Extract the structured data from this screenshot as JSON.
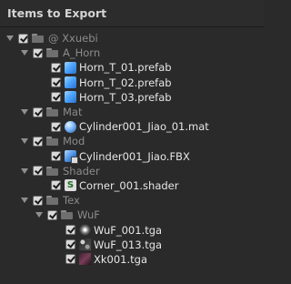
{
  "header": {
    "title": "Items to Export"
  },
  "tree": [
    {
      "level": 0,
      "expanded": true,
      "type": "folder",
      "name": "@ Xxuebi"
    },
    {
      "level": 1,
      "expanded": true,
      "type": "folder",
      "name": "A_Horn"
    },
    {
      "level": 2,
      "type": "prefab",
      "name": "Horn_T_01.prefab"
    },
    {
      "level": 2,
      "type": "prefab",
      "name": "Horn_T_02.prefab"
    },
    {
      "level": 2,
      "type": "prefab",
      "name": "Horn_T_03.prefab"
    },
    {
      "level": 1,
      "expanded": true,
      "type": "folder",
      "name": "Mat"
    },
    {
      "level": 2,
      "type": "mat",
      "name": "Cylinder001_Jiao_01.mat"
    },
    {
      "level": 1,
      "expanded": true,
      "type": "folder",
      "name": "Mod"
    },
    {
      "level": 2,
      "type": "fbx",
      "name": "Cylinder001_Jiao.FBX"
    },
    {
      "level": 1,
      "expanded": true,
      "type": "folder",
      "name": "Shader"
    },
    {
      "level": 2,
      "type": "shader",
      "name": "Corner_001.shader"
    },
    {
      "level": 1,
      "expanded": true,
      "type": "folder",
      "name": "Tex"
    },
    {
      "level": 2,
      "expanded": true,
      "type": "folder",
      "name": "WuF"
    },
    {
      "level": 3,
      "type": "tga1",
      "name": "WuF_001.tga"
    },
    {
      "level": 3,
      "type": "tga2",
      "name": "WuF_013.tga"
    },
    {
      "level": 3,
      "type": "tga3",
      "name": "Xk001.tga"
    }
  ]
}
